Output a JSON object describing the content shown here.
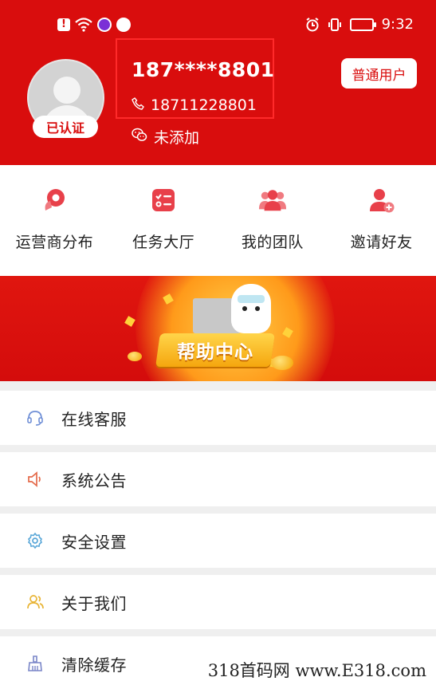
{
  "status_bar": {
    "time": "9:32",
    "left_icons": [
      "alert-icon",
      "wifi-icon",
      "app-icon",
      "browser-icon"
    ],
    "right_icons": [
      "alarm-icon",
      "vibrate-icon",
      "battery-icon"
    ]
  },
  "profile": {
    "username": "187****8801",
    "phone": "18711228801",
    "wechat_status": "未添加",
    "verified_label": "已认证",
    "user_type": "普通用户"
  },
  "quick_nav": [
    {
      "label": "运营商分布",
      "icon": "map-pin-icon"
    },
    {
      "label": "任务大厅",
      "icon": "task-list-icon"
    },
    {
      "label": "我的团队",
      "icon": "team-icon"
    },
    {
      "label": "邀请好友",
      "icon": "invite-user-icon"
    }
  ],
  "banner": {
    "title": "帮助中心"
  },
  "menu": [
    {
      "label": "在线客服",
      "icon": "headset-icon",
      "color": "#6f8fd6"
    },
    {
      "label": "系统公告",
      "icon": "speaker-icon",
      "color": "#e46a4a"
    },
    {
      "label": "安全设置",
      "icon": "gear-icon",
      "color": "#5aa7d8"
    },
    {
      "label": "关于我们",
      "icon": "users-icon",
      "color": "#e8b435"
    },
    {
      "label": "清除缓存",
      "icon": "broom-icon",
      "color": "#7a86c8"
    }
  ],
  "watermark": "318首码网 www.E318.com",
  "colors": {
    "primary": "#d90d0d",
    "background": "#efefef"
  }
}
